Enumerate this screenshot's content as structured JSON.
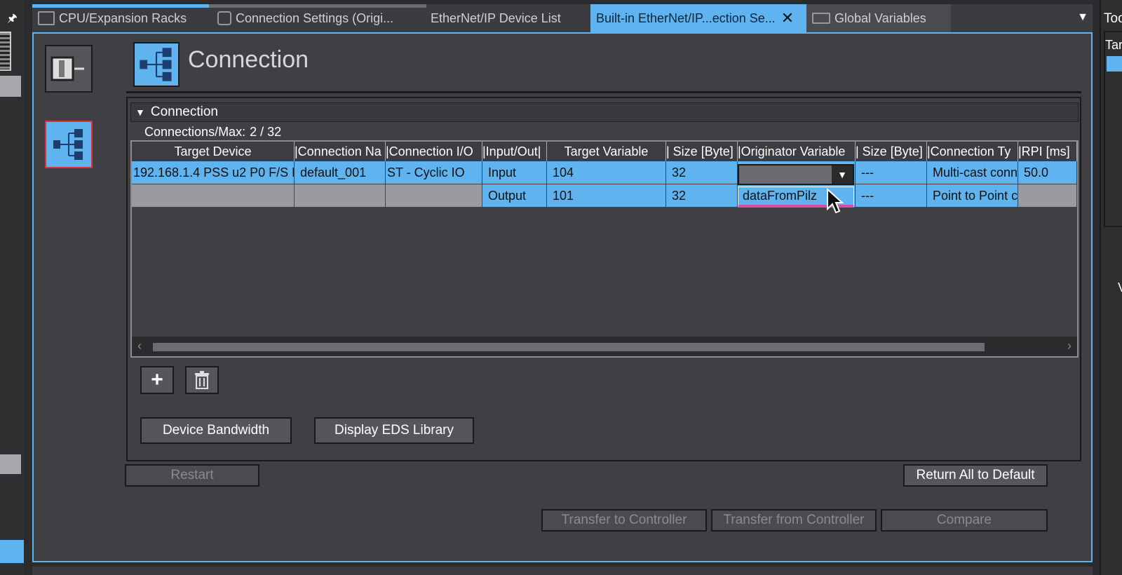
{
  "tabs": [
    {
      "label": "CPU/Expansion Racks",
      "active": false
    },
    {
      "label": "Connection Settings (Origi...",
      "active": false
    },
    {
      "label": "EtherNet/IP Device List",
      "active": false
    },
    {
      "label": "Built-in EtherNet/IP...ection Se...",
      "active": true
    },
    {
      "label": "Global Variables",
      "active": false
    }
  ],
  "tab_close_glyph": "✕",
  "tab_menu_glyph": "▼",
  "page_title": "Connection",
  "section": {
    "title": "Connection",
    "count_label": "Connections/Max:",
    "count_value": "2 / 32"
  },
  "table": {
    "headers": [
      "Target Device",
      "|Connection Na",
      "|Connection I/O",
      "|Input/Out|",
      "Target Variable",
      "| Size [Byte]",
      "|Originator Variable",
      "| Size [Byte]",
      "|Connection Ty",
      "|RPI [ms]"
    ],
    "rows": [
      [
        "192.168.1.4 PSS u2 P0 F/S E",
        "default_001",
        "ST - Cyclic IO",
        "Input",
        "104",
        "32",
        "",
        "---",
        "Multi-cast conn",
        "50.0"
      ],
      [
        "",
        "",
        "",
        "Output",
        "101",
        "32",
        "dataFromPilz",
        "---",
        "Point to Point c",
        ""
      ]
    ]
  },
  "dropdown": {
    "selected": "",
    "option": "dataFromPilz"
  },
  "buttons": {
    "add": "+",
    "device_bandwidth": "Device Bandwidth",
    "display_eds": "Display EDS Library",
    "restart": "Restart",
    "return_default": "Return All to Default",
    "transfer_to": "Transfer to Controller",
    "transfer_from": "Transfer from Controller",
    "compare": "Compare"
  },
  "right_panel": {
    "title": "Too",
    "label": "Tar",
    "label2": "V"
  },
  "colors": {
    "accent": "#5fb4f0",
    "panel": "#3f3f44",
    "highlight": "#d94fa0",
    "selected_border": "#e0303a"
  }
}
